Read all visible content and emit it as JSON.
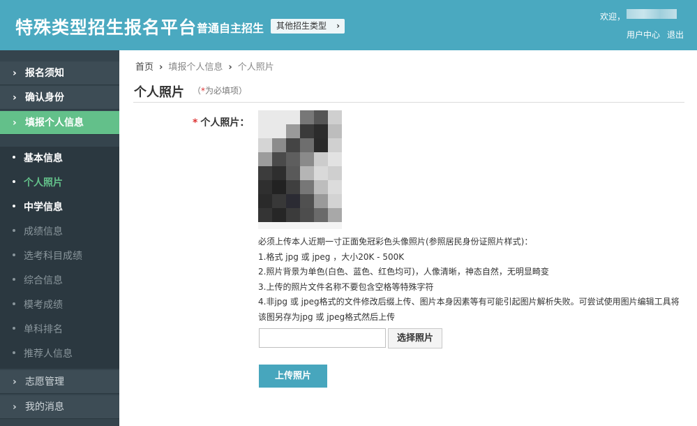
{
  "header": {
    "brand": "特殊类型招生报名平台",
    "subtitle": "普通自主招生",
    "type_button": "其他招生类型",
    "welcome": "欢迎，",
    "user_center": "用户中心",
    "logout": "退出"
  },
  "sidebar": {
    "sections": [
      {
        "label": "报名须知"
      },
      {
        "label": "确认身份"
      },
      {
        "label": "填报个人信息"
      }
    ],
    "sub_items": [
      {
        "label": "基本信息"
      },
      {
        "label": "个人照片"
      },
      {
        "label": "中学信息"
      },
      {
        "label": "成绩信息"
      },
      {
        "label": "选考科目成绩"
      },
      {
        "label": "综合信息"
      },
      {
        "label": "模考成绩"
      },
      {
        "label": "单科排名"
      },
      {
        "label": "推荐人信息"
      }
    ],
    "bottom_sections": [
      {
        "label": "志愿管理"
      },
      {
        "label": "我的消息"
      }
    ]
  },
  "breadcrumb": {
    "home": "首页",
    "parent": "填报个人信息",
    "current": "个人照片"
  },
  "page": {
    "title": "个人照片",
    "required_star": "*",
    "required_note": "为必填项",
    "field_label": "个人照片："
  },
  "instructions": [
    "必须上传本人近期一寸正面免冠彩色头像照片(参照居民身份证照片样式)：",
    "1.格式 jpg 或 jpeg ，大小20K - 500K",
    "2.照片背景为单色(白色、蓝色、红色均可)，人像清晰，神态自然，无明显畸变",
    "3.上传的照片文件名称不要包含空格等特殊字符",
    "4.非jpg 或 jpeg格式的文件修改后缀上传、图片本身因素等有可能引起图片解析失败。可尝试使用图片编辑工具将该图另存为jpg 或 jpeg格式然后上传"
  ],
  "upload": {
    "file_value": "",
    "choose_label": "选择照片",
    "upload_label": "上传照片"
  },
  "colors": {
    "header": "#4aa9c0",
    "sidebar": "#35444d",
    "active": "#63c08a",
    "required": "#dd3333"
  }
}
